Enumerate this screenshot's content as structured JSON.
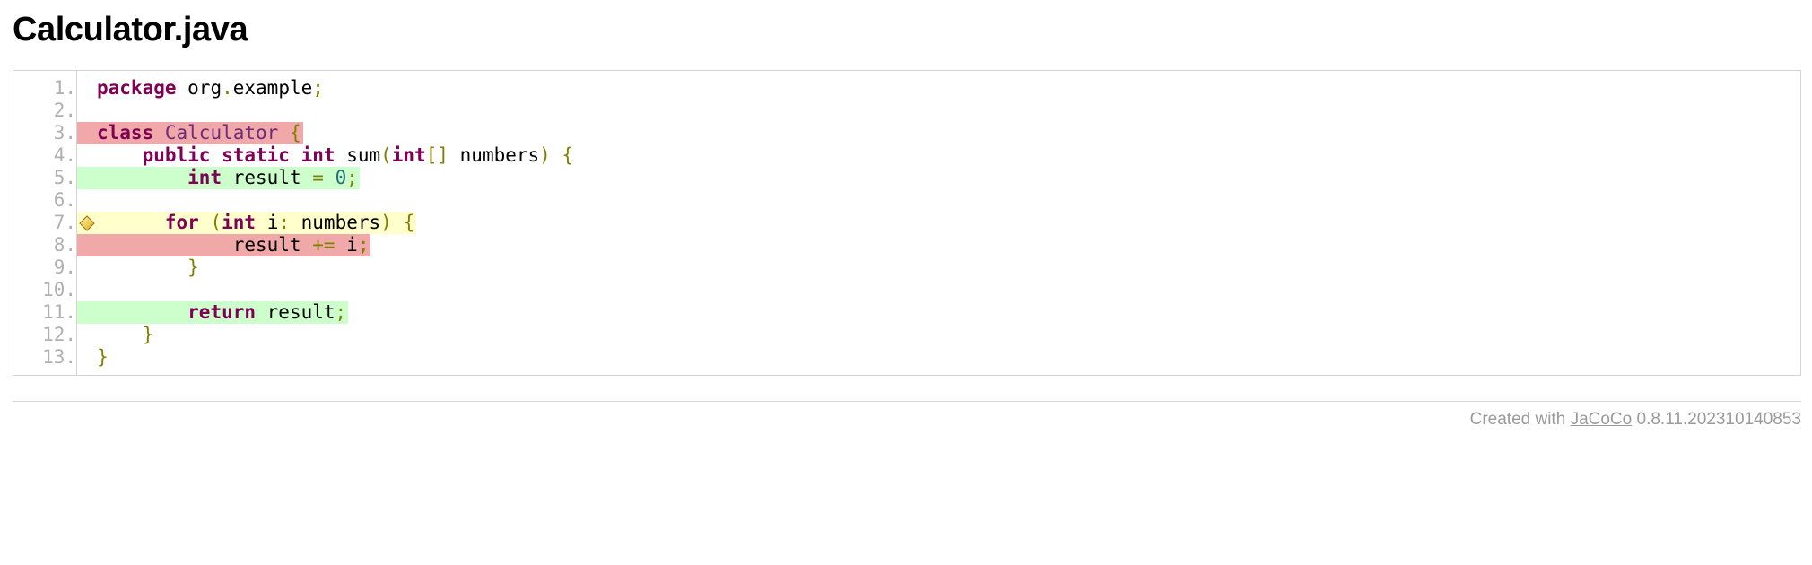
{
  "page_title": "Calculator.java",
  "colors": {
    "covered": "#ccffcc",
    "uncovered": "#f0a8a8",
    "partial": "#ffffcc",
    "keyword": "#7f0055",
    "class_name": "#6b2b7a",
    "punctuation": "#808000",
    "number": "#20707a",
    "line_number": "#b0b0b0",
    "border": "#d6d3d0",
    "footer_text": "#9a9a9a"
  },
  "source": {
    "language": "java",
    "lines": [
      {
        "number": "1.",
        "coverage": "plain",
        "branch_marker": "none",
        "text": "package org.example;",
        "tokens": [
          {
            "t": "package",
            "c": "kw"
          },
          {
            "t": " org",
            "c": "pln"
          },
          {
            "t": ".",
            "c": "pun"
          },
          {
            "t": "example",
            "c": "pln"
          },
          {
            "t": ";",
            "c": "pun"
          }
        ]
      },
      {
        "number": "2.",
        "coverage": "plain",
        "branch_marker": "none",
        "text": "",
        "tokens": []
      },
      {
        "number": "3.",
        "coverage": "uncovered",
        "branch_marker": "none",
        "text": "class Calculator {",
        "tokens": [
          {
            "t": "class",
            "c": "kw"
          },
          {
            "t": " ",
            "c": "pln"
          },
          {
            "t": "Calculator",
            "c": "cls"
          },
          {
            "t": " ",
            "c": "pln"
          },
          {
            "t": "{",
            "c": "pun"
          }
        ]
      },
      {
        "number": "4.",
        "coverage": "plain",
        "branch_marker": "none",
        "text": "    public static int sum(int[] numbers) {",
        "tokens": [
          {
            "t": "    ",
            "c": "pln"
          },
          {
            "t": "public",
            "c": "kw"
          },
          {
            "t": " ",
            "c": "pln"
          },
          {
            "t": "static",
            "c": "kw"
          },
          {
            "t": " ",
            "c": "pln"
          },
          {
            "t": "int",
            "c": "typ"
          },
          {
            "t": " sum",
            "c": "pln"
          },
          {
            "t": "(",
            "c": "pun"
          },
          {
            "t": "int",
            "c": "typ"
          },
          {
            "t": "[]",
            "c": "pun"
          },
          {
            "t": " numbers",
            "c": "pln"
          },
          {
            "t": ")",
            "c": "pun"
          },
          {
            "t": " ",
            "c": "pln"
          },
          {
            "t": "{",
            "c": "pun"
          }
        ]
      },
      {
        "number": "5.",
        "coverage": "covered",
        "branch_marker": "none",
        "text": "        int result = 0;",
        "tokens": [
          {
            "t": "        ",
            "c": "pln"
          },
          {
            "t": "int",
            "c": "typ"
          },
          {
            "t": " result ",
            "c": "pln"
          },
          {
            "t": "=",
            "c": "opr"
          },
          {
            "t": " ",
            "c": "pln"
          },
          {
            "t": "0",
            "c": "num"
          },
          {
            "t": ";",
            "c": "pun"
          }
        ]
      },
      {
        "number": "6.",
        "coverage": "plain",
        "branch_marker": "none",
        "text": "",
        "tokens": []
      },
      {
        "number": "7.",
        "coverage": "partial",
        "branch_marker": "partial-branch-diamond",
        "text": "        for (int i: numbers) {",
        "tokens": [
          {
            "t": "      ",
            "c": "pln"
          },
          {
            "t": "for",
            "c": "kw"
          },
          {
            "t": " ",
            "c": "pln"
          },
          {
            "t": "(",
            "c": "pun"
          },
          {
            "t": "int",
            "c": "typ"
          },
          {
            "t": " i",
            "c": "pln"
          },
          {
            "t": ":",
            "c": "pun"
          },
          {
            "t": " numbers",
            "c": "pln"
          },
          {
            "t": ")",
            "c": "pun"
          },
          {
            "t": " ",
            "c": "pln"
          },
          {
            "t": "{",
            "c": "pun"
          }
        ]
      },
      {
        "number": "8.",
        "coverage": "uncovered",
        "branch_marker": "none",
        "text": "            result += i;",
        "tokens": [
          {
            "t": "            result ",
            "c": "pln"
          },
          {
            "t": "+=",
            "c": "opr"
          },
          {
            "t": " i",
            "c": "pln"
          },
          {
            "t": ";",
            "c": "pun"
          }
        ]
      },
      {
        "number": "9.",
        "coverage": "plain",
        "branch_marker": "none",
        "text": "        }",
        "tokens": [
          {
            "t": "        ",
            "c": "pln"
          },
          {
            "t": "}",
            "c": "pun"
          }
        ]
      },
      {
        "number": "10.",
        "coverage": "plain",
        "branch_marker": "none",
        "text": "",
        "tokens": []
      },
      {
        "number": "11.",
        "coverage": "covered",
        "branch_marker": "none",
        "text": "        return result;",
        "tokens": [
          {
            "t": "        ",
            "c": "pln"
          },
          {
            "t": "return",
            "c": "kw"
          },
          {
            "t": " result",
            "c": "pln"
          },
          {
            "t": ";",
            "c": "pun"
          }
        ]
      },
      {
        "number": "12.",
        "coverage": "plain",
        "branch_marker": "none",
        "text": "    }",
        "tokens": [
          {
            "t": "    ",
            "c": "pln"
          },
          {
            "t": "}",
            "c": "pun"
          }
        ]
      },
      {
        "number": "13.",
        "coverage": "plain",
        "branch_marker": "none",
        "text": "}",
        "tokens": [
          {
            "t": "}",
            "c": "pun"
          }
        ]
      }
    ]
  },
  "footer": {
    "prefix": "Created with ",
    "link_label": "JaCoCo",
    "version": " 0.8.11.202310140853"
  }
}
